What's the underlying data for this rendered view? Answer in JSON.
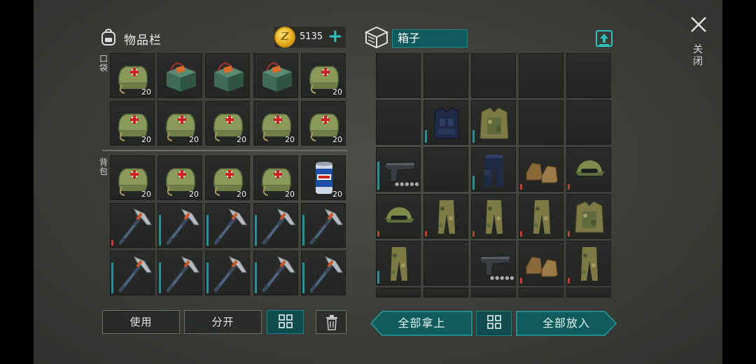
{
  "inventory": {
    "title": "物品栏",
    "gold": "5135",
    "add_symbol": "+",
    "pocket_label": "口袋",
    "backpack_label": "背包",
    "slots": [
      {
        "item": "first-aid-kit",
        "count": "20"
      },
      {
        "item": "ammo-crate",
        "count": ""
      },
      {
        "item": "ammo-crate",
        "count": ""
      },
      {
        "item": "ammo-crate",
        "count": ""
      },
      {
        "item": "first-aid-kit",
        "count": "20"
      },
      {
        "item": "first-aid-kit",
        "count": "20"
      },
      {
        "item": "first-aid-kit",
        "count": "20"
      },
      {
        "item": "first-aid-kit",
        "count": "20"
      },
      {
        "item": "first-aid-kit",
        "count": "20"
      },
      {
        "item": "first-aid-kit",
        "count": "20"
      },
      {
        "item": "first-aid-kit",
        "count": "20"
      },
      {
        "item": "first-aid-kit",
        "count": "20"
      },
      {
        "item": "first-aid-kit",
        "count": "20"
      },
      {
        "item": "first-aid-kit",
        "count": "20"
      },
      {
        "item": "beer-can",
        "count": "20"
      },
      {
        "item": "pickaxe",
        "count": ""
      },
      {
        "item": "pickaxe",
        "count": ""
      },
      {
        "item": "pickaxe",
        "count": ""
      },
      {
        "item": "pickaxe",
        "count": ""
      },
      {
        "item": "pickaxe",
        "count": ""
      },
      {
        "item": "pickaxe",
        "count": ""
      },
      {
        "item": "pickaxe",
        "count": ""
      },
      {
        "item": "pickaxe",
        "count": ""
      },
      {
        "item": "pickaxe",
        "count": ""
      },
      {
        "item": "pickaxe",
        "count": ""
      }
    ],
    "use_label": "使用",
    "split_label": "分开"
  },
  "container": {
    "name": "箱子",
    "take_all_label": "全部拿上",
    "put_all_label": "全部放入",
    "slots": [
      "",
      "",
      "",
      "",
      "",
      "",
      "tactical-vest-blue",
      "camo-vest",
      "",
      "",
      "pistol",
      "",
      "police-pants",
      "leather-boots",
      "camo-cap",
      "camo-cap",
      "camo-pants",
      "camo-pants",
      "camo-pants",
      "camo-vest",
      "camo-pants",
      "",
      "pistol",
      "leather-boots",
      "camo-pants"
    ]
  },
  "close_label": "关闭",
  "colors": {
    "accent": "#1e8a8a",
    "durability_teal": "#2d8d95",
    "durability_red": "#c63a2d",
    "gold": "#e3a915"
  }
}
